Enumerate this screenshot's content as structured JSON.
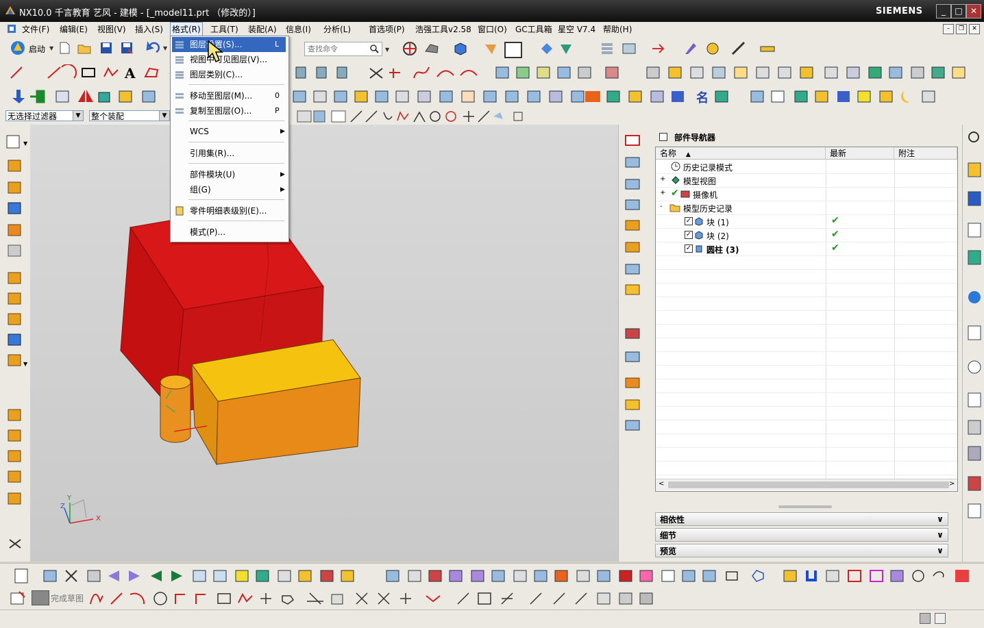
{
  "window": {
    "title": "NX10.0 千言教育 艺风 - 建模 - [_model11.prt （修改的）]",
    "brand": "SIEMENS",
    "controls": [
      "_",
      "□",
      "✕"
    ]
  },
  "menubar": {
    "items": [
      "文件(F)",
      "编辑(E)",
      "视图(V)",
      "插入(S)",
      "格式(R)",
      "工具(T)",
      "装配(A)",
      "信息(I)",
      "分析(L)",
      "首选项(P)",
      "浩强工具v2.58",
      "窗口(O)",
      "GC工具箱",
      "星空 V7.4",
      "帮助(H)"
    ],
    "active_index": 4
  },
  "toolbar": {
    "start_label": "启动",
    "search_placeholder": "查找命令"
  },
  "filter": {
    "selection_filter": "无选择过滤器",
    "scope": "整个装配"
  },
  "format_menu": {
    "items": [
      {
        "label": "图层设置(S)...",
        "shortcut": "L",
        "icon": "layer-settings-icon",
        "selected": true
      },
      {
        "label": "视图中可见图层(V)...",
        "shortcut": "",
        "icon": "visible-layers-icon"
      },
      {
        "label": "图层类别(C)...",
        "shortcut": "",
        "icon": "layer-category-icon"
      },
      {
        "separator": true
      },
      {
        "label": "移动至图层(M)...",
        "shortcut": "0",
        "icon": "move-to-layer-icon"
      },
      {
        "label": "复制至图层(O)...",
        "shortcut": "P",
        "icon": "copy-to-layer-icon"
      },
      {
        "separator": true
      },
      {
        "label": "WCS",
        "submenu": true
      },
      {
        "separator": true
      },
      {
        "label": "引用集(R)..."
      },
      {
        "separator": true
      },
      {
        "label": "部件模块(U)",
        "submenu": true
      },
      {
        "label": "组(G)",
        "submenu": true
      },
      {
        "separator": true
      },
      {
        "label": "零件明细表级别(E)...",
        "icon": "parts-list-icon"
      },
      {
        "separator": true
      },
      {
        "label": "模式(P)..."
      }
    ]
  },
  "navigator": {
    "title": "部件导航器",
    "columns": [
      "名称",
      "最新",
      "附注"
    ],
    "rows": [
      {
        "label": "历史记录模式",
        "level": 0,
        "icon": "clock-icon",
        "expander": "",
        "latest": ""
      },
      {
        "label": "模型视图",
        "level": 0,
        "icon": "model-views-icon",
        "expander": "+",
        "latest": ""
      },
      {
        "label": "摄像机",
        "level": 0,
        "icon": "camera-icon",
        "expander": "+",
        "latest": ""
      },
      {
        "label": "模型历史记录",
        "level": 0,
        "icon": "folder-icon",
        "expander": "-",
        "latest": ""
      },
      {
        "label": "块 (1)",
        "level": 1,
        "icon": "block-icon",
        "checked": true,
        "latest": "✔"
      },
      {
        "label": "块 (2)",
        "level": 1,
        "icon": "block-icon",
        "checked": true,
        "latest": "✔"
      },
      {
        "label": "圆柱 (3)",
        "level": 1,
        "icon": "cylinder-icon",
        "checked": true,
        "bold": true,
        "latest": "✔"
      }
    ],
    "sections": [
      "相依性",
      "细节",
      "预览"
    ]
  },
  "sketch": {
    "finish_label": "完成草图"
  },
  "triad": {
    "x": "X",
    "y": "Y",
    "z": "Z"
  },
  "colors": {
    "red_block": "#d41414",
    "orange_block": "#f0a818",
    "highlight": "#3468c0"
  }
}
